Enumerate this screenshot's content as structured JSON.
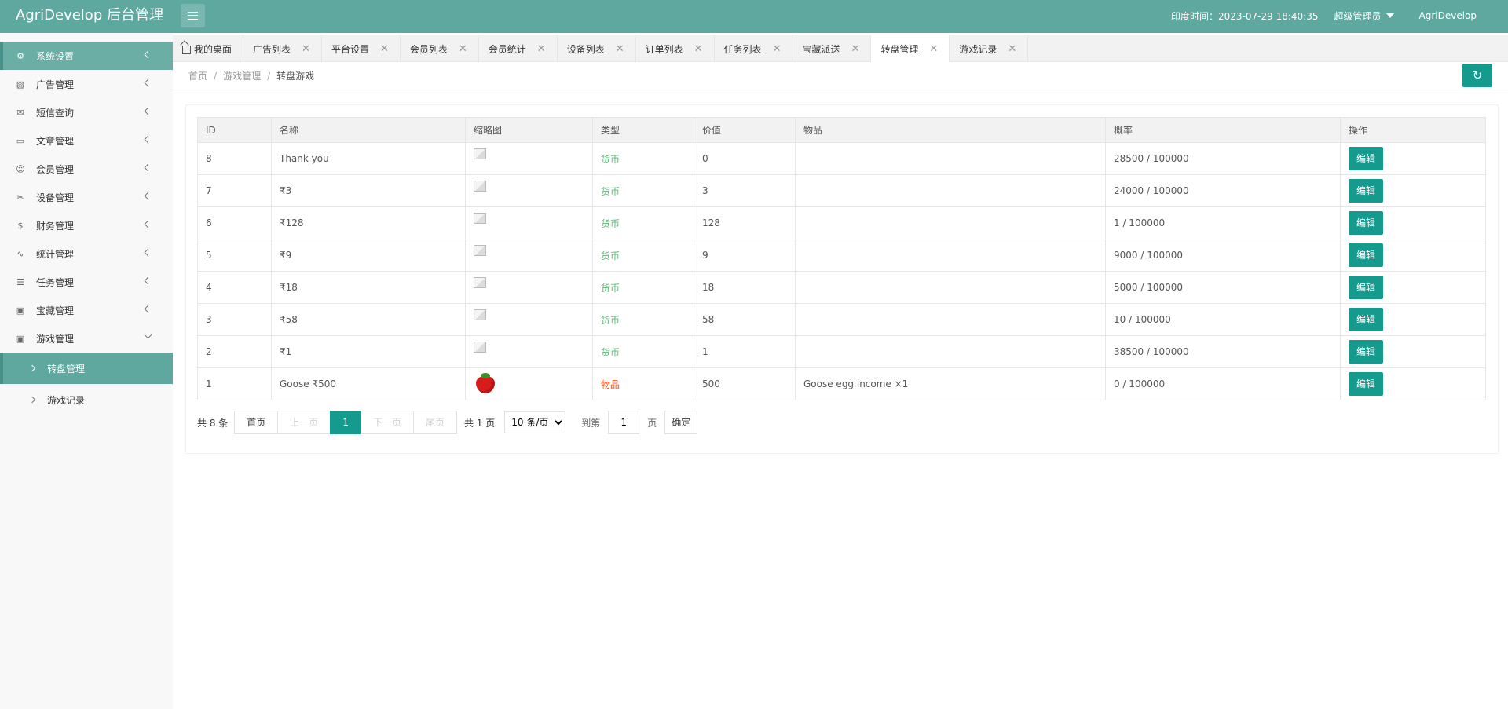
{
  "header": {
    "logo": "AgriDevelop 后台管理",
    "time": "印度时间：2023-07-29 18:40:35",
    "user": "超级管理员",
    "app": "AgriDevelop"
  },
  "sidebar": {
    "items": [
      {
        "label": "系统设置",
        "icon": "gear-icon"
      },
      {
        "label": "广告管理",
        "icon": "image-icon"
      },
      {
        "label": "短信查询",
        "icon": "mail-icon"
      },
      {
        "label": "文章管理",
        "icon": "book-icon"
      },
      {
        "label": "会员管理",
        "icon": "user-icon"
      },
      {
        "label": "设备管理",
        "icon": "tool-icon"
      },
      {
        "label": "财务管理",
        "icon": "dollar-icon"
      },
      {
        "label": "统计管理",
        "icon": "pulse-icon"
      },
      {
        "label": "任务管理",
        "icon": "sliders-icon"
      },
      {
        "label": "宝藏管理",
        "icon": "gift-icon"
      },
      {
        "label": "游戏管理",
        "icon": "gift-icon"
      }
    ],
    "subitems": [
      {
        "label": "转盘管理"
      },
      {
        "label": "游戏记录"
      }
    ]
  },
  "tabs": [
    {
      "label": "我的桌面"
    },
    {
      "label": "广告列表"
    },
    {
      "label": "平台设置"
    },
    {
      "label": "会员列表"
    },
    {
      "label": "会员统计"
    },
    {
      "label": "设备列表"
    },
    {
      "label": "订单列表"
    },
    {
      "label": "任务列表"
    },
    {
      "label": "宝藏派送"
    },
    {
      "label": "转盘管理"
    },
    {
      "label": "游戏记录"
    }
  ],
  "breadcrumb": {
    "home": "首页",
    "parent": "游戏管理",
    "current": "转盘游戏",
    "sep": "/"
  },
  "table": {
    "headers": [
      "ID",
      "名称",
      "缩略图",
      "类型",
      "价值",
      "物品",
      "概率",
      "操作"
    ],
    "rows": [
      {
        "id": "8",
        "name": "Thank you",
        "type": "货币",
        "value": "0",
        "item": "",
        "prob": "28500 / 100000"
      },
      {
        "id": "7",
        "name": "₹3",
        "type": "货币",
        "value": "3",
        "item": "",
        "prob": "24000 / 100000"
      },
      {
        "id": "6",
        "name": "₹128",
        "type": "货币",
        "value": "128",
        "item": "",
        "prob": "1 / 100000"
      },
      {
        "id": "5",
        "name": "₹9",
        "type": "货币",
        "value": "9",
        "item": "",
        "prob": "9000 / 100000"
      },
      {
        "id": "4",
        "name": "₹18",
        "type": "货币",
        "value": "18",
        "item": "",
        "prob": "5000 / 100000"
      },
      {
        "id": "3",
        "name": "₹58",
        "type": "货币",
        "value": "58",
        "item": "",
        "prob": "10 / 100000"
      },
      {
        "id": "2",
        "name": "₹1",
        "type": "货币",
        "value": "1",
        "item": "",
        "prob": "38500 / 100000"
      },
      {
        "id": "1",
        "name": "Goose ₹500",
        "type": "物品",
        "value": "500",
        "item": "Goose egg income ×1",
        "prob": "0 / 100000"
      }
    ],
    "edit_label": "编辑"
  },
  "pager": {
    "total": "共 8 条",
    "first": "首页",
    "prev": "上一页",
    "current": "1",
    "next": "下一页",
    "last": "尾页",
    "pages": "共 1 页",
    "per_page": "10 条/页",
    "goto": "到第",
    "goto_value": "1",
    "page_unit": "页",
    "confirm": "确定"
  },
  "colors": {
    "header": "#5fa8a0",
    "accent": "#159a8e",
    "currency": "#5fb878",
    "item": "#ff5722"
  }
}
